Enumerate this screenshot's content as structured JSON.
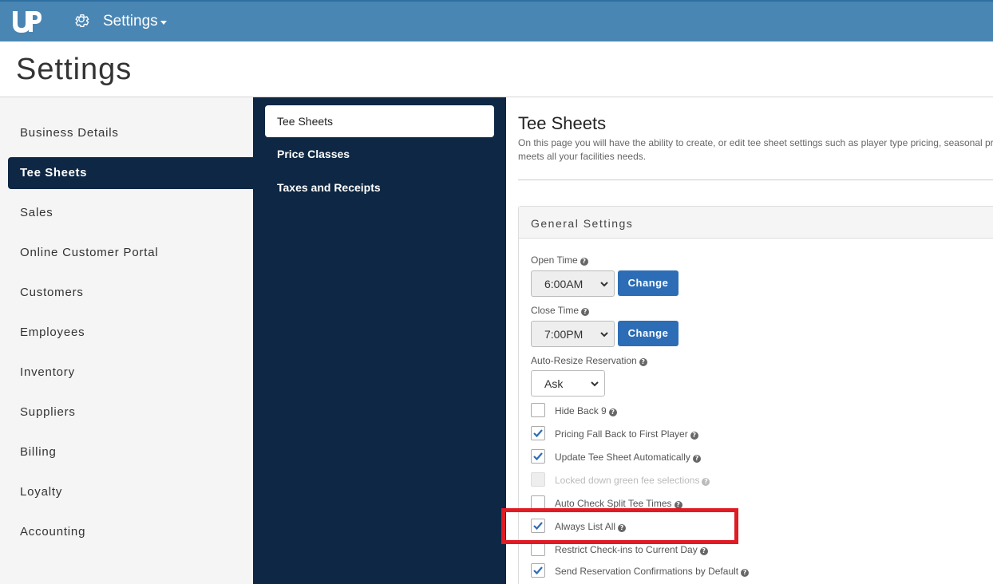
{
  "topbar": {
    "logo_text": "UP",
    "menu_label": "Settings",
    "icons": {
      "gear": "gear-icon",
      "caret": "caret-down-icon"
    }
  },
  "page_title": "Settings",
  "leftnav": {
    "items": [
      "Business Details",
      "Tee Sheets",
      "Sales",
      "Online Customer Portal",
      "Customers",
      "Employees",
      "Inventory",
      "Suppliers",
      "Billing",
      "Loyalty",
      "Accounting"
    ],
    "active": "Tee Sheets"
  },
  "subnav": {
    "items": [
      "Tee Sheets",
      "Price Classes",
      "Taxes and Receipts"
    ],
    "selected": "Tee Sheets"
  },
  "content": {
    "title": "Tee Sheets",
    "desc_line1": "On this page you will have the ability to create, or edit tee sheet settings such as player type pricing, seasonal pri",
    "desc_line2": "meets all your facilities needs."
  },
  "general": {
    "heading": "General Settings",
    "open_time": {
      "label": "Open Time",
      "value": "6:00AM",
      "button": "Change"
    },
    "close_time": {
      "label": "Close Time",
      "value": "7:00PM",
      "button": "Change"
    },
    "auto_resize": {
      "label": "Auto-Resize Reservation",
      "value": "Ask"
    },
    "checkboxes": [
      {
        "label": "Hide Back 9",
        "checked": false,
        "disabled": false
      },
      {
        "label": "Pricing Fall Back to First Player",
        "checked": true,
        "disabled": false
      },
      {
        "label": "Update Tee Sheet Automatically",
        "checked": true,
        "disabled": false
      },
      {
        "label": "Locked down green fee selections",
        "checked": false,
        "disabled": true
      },
      {
        "label": "Auto Check Split Tee Times",
        "checked": false,
        "disabled": false
      },
      {
        "label": "Always List All",
        "checked": true,
        "disabled": false
      },
      {
        "label": "Restrict Check-ins to Current Day",
        "checked": false,
        "disabled": false
      },
      {
        "label": "Send Reservation Confirmations by Default",
        "checked": true,
        "disabled": false
      }
    ]
  },
  "colors": {
    "topbar": "#4a86b4",
    "nav_dark": "#0d2744",
    "button": "#2d6db5",
    "check": "#2d6db5",
    "highlight": "#e01b24"
  }
}
